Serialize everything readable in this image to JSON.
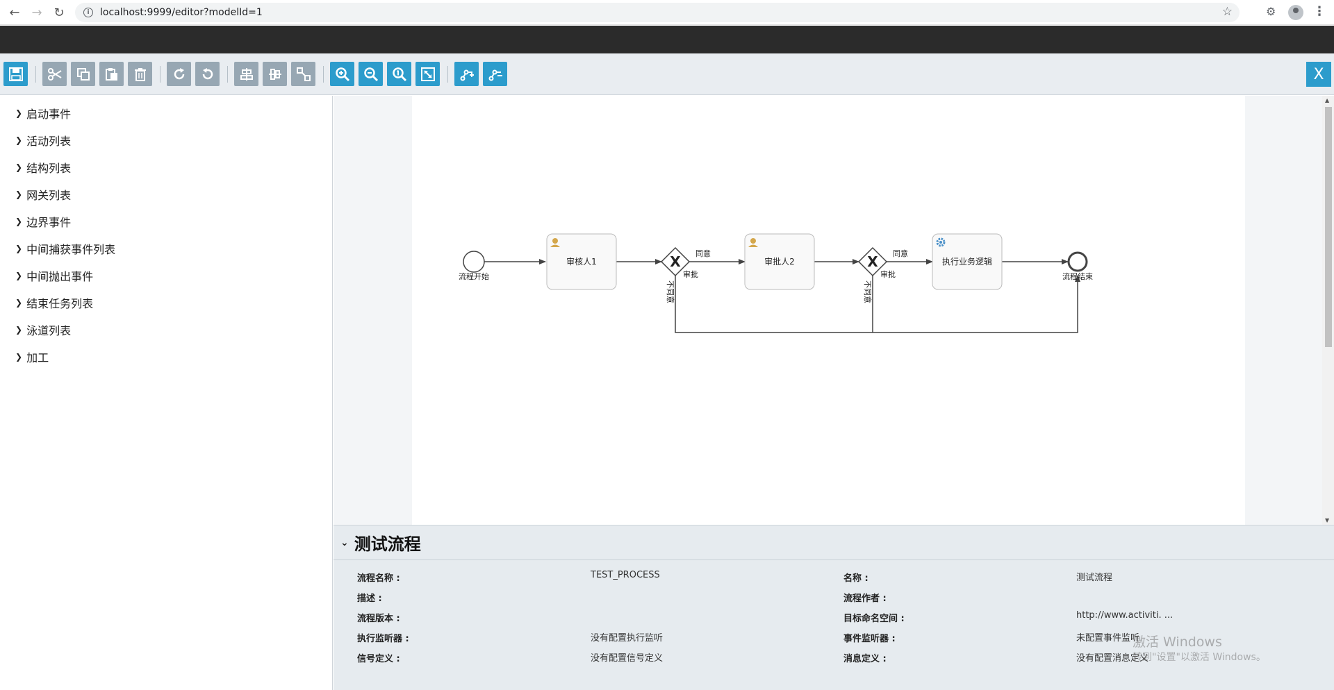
{
  "browser": {
    "url": "localhost:9999/editor?modelId=1"
  },
  "toolbar": {
    "buttons": [
      {
        "name": "save",
        "icon": "save-icon",
        "style": "blue"
      },
      {
        "name": "cut",
        "icon": "scissors-icon",
        "style": "gray"
      },
      {
        "name": "copy",
        "icon": "copy-icon",
        "style": "gray"
      },
      {
        "name": "paste",
        "icon": "paste-icon",
        "style": "gray"
      },
      {
        "name": "delete",
        "icon": "trash-icon",
        "style": "gray"
      },
      {
        "name": "redo",
        "icon": "redo-icon",
        "style": "gray"
      },
      {
        "name": "undo",
        "icon": "undo-icon",
        "style": "gray"
      },
      {
        "name": "align-horizontal",
        "icon": "align-horizontal-icon",
        "style": "gray"
      },
      {
        "name": "align-vertical",
        "icon": "align-vertical-icon",
        "style": "gray"
      },
      {
        "name": "same-size",
        "icon": "same-size-icon",
        "style": "gray"
      },
      {
        "name": "zoom-in",
        "icon": "zoom-in-icon",
        "style": "blue"
      },
      {
        "name": "zoom-out",
        "icon": "zoom-out-icon",
        "style": "blue"
      },
      {
        "name": "zoom-actual",
        "icon": "zoom-actual-icon",
        "style": "blue"
      },
      {
        "name": "zoom-fit",
        "icon": "zoom-fit-icon",
        "style": "blue"
      },
      {
        "name": "add-bendpoint",
        "icon": "add-bendpoint-icon",
        "style": "blue"
      },
      {
        "name": "remove-bendpoint",
        "icon": "remove-bendpoint-icon",
        "style": "blue"
      }
    ],
    "close_label": "X"
  },
  "palette": {
    "items": [
      {
        "label": "启动事件"
      },
      {
        "label": "活动列表"
      },
      {
        "label": "结构列表"
      },
      {
        "label": "网关列表"
      },
      {
        "label": "边界事件"
      },
      {
        "label": "中间捕获事件列表"
      },
      {
        "label": "中间抛出事件"
      },
      {
        "label": "结束任务列表"
      },
      {
        "label": "泳道列表"
      },
      {
        "label": "加工"
      }
    ]
  },
  "diagram": {
    "start_label": "流程开始",
    "task1_label": "审核人1",
    "task2_label": "审批人2",
    "task3_label": "执行业务逻辑",
    "end_label": "流程结束",
    "flow_agree": "同意",
    "flow_approve": "审批",
    "flow_disagree": "不同意"
  },
  "properties": {
    "title": "测试流程",
    "rows": [
      {
        "left_label": "流程名称 :",
        "left_value": "TEST_PROCESS",
        "right_label": "名称 :",
        "right_value": "测试流程"
      },
      {
        "left_label": "描述 :",
        "left_value": "",
        "right_label": "流程作者 :",
        "right_value": ""
      },
      {
        "left_label": "流程版本 :",
        "left_value": "",
        "right_label": "目标命名空间 :",
        "right_value": "http://www.activiti. ..."
      },
      {
        "left_label": "执行监听器 :",
        "left_value": "没有配置执行监听",
        "right_label": "事件监听器 :",
        "right_value": "未配置事件监听"
      },
      {
        "left_label": "信号定义 :",
        "left_value": "没有配置信号定义",
        "right_label": "消息定义 :",
        "right_value": "没有配置消息定义"
      }
    ]
  },
  "os_watermark": {
    "line1": "激活 Windows",
    "line2": "转到\"设置\"以激活 Windows。"
  },
  "colors": {
    "accent": "#2c9ccc",
    "toolbar_gray": "#97a7b3",
    "dark_header": "#2b2b2b",
    "panel_bg": "#e6ebef"
  }
}
